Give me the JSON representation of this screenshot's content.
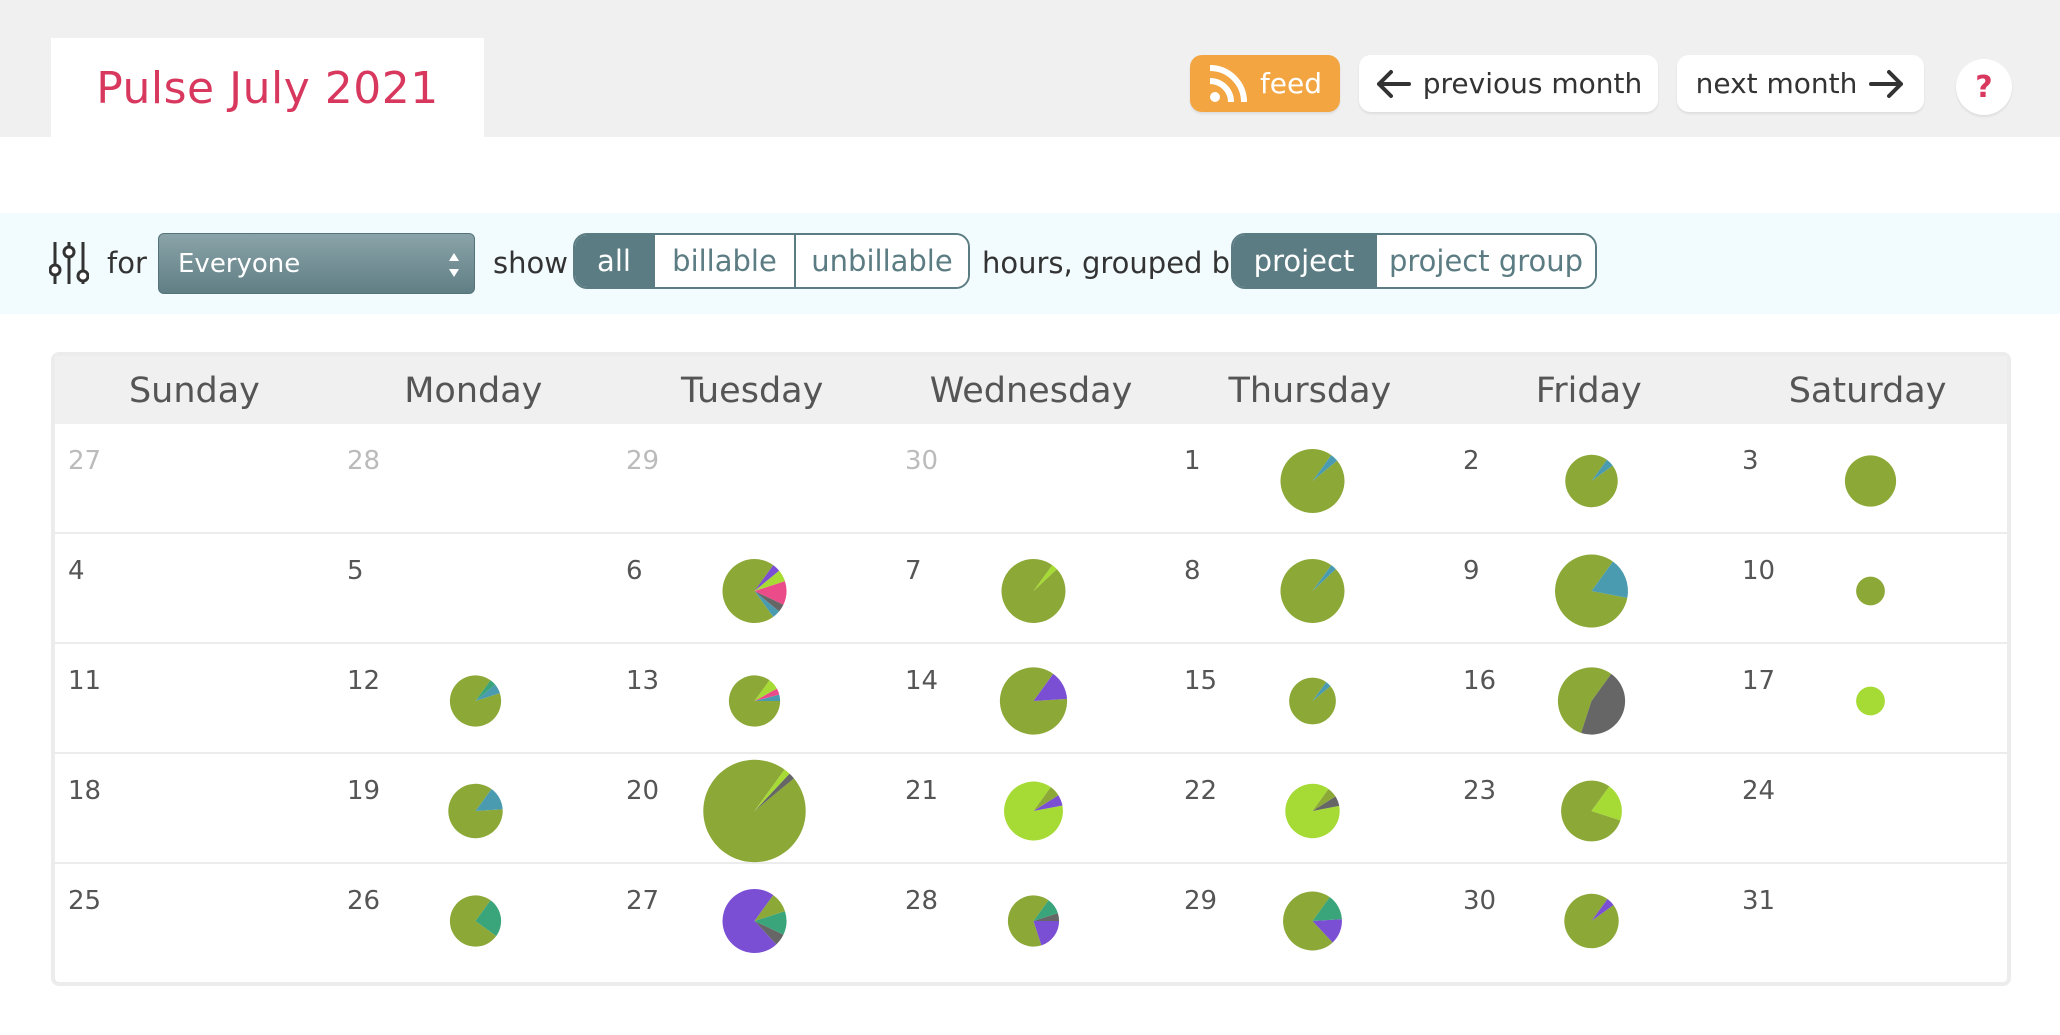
{
  "title": "Pulse July 2021",
  "nav": {
    "feed_label": "feed",
    "prev_label": "previous month",
    "next_label": "next month",
    "help_label": "?"
  },
  "filter": {
    "for_label": "for",
    "person_select": "Everyone",
    "show_label": "show",
    "hours_options": [
      "all",
      "billable",
      "unbillable"
    ],
    "hours_selected": "all",
    "grouped_label": "hours, grouped by",
    "group_options": [
      "project",
      "project group"
    ],
    "group_selected": "project"
  },
  "colors": {
    "accent": "#d8385e",
    "feed": "#f2a541",
    "segment": "#5b7c82",
    "olive": "#8ca836",
    "lime": "#a6da34",
    "teal": "#4b9bb0",
    "purple": "#7b4fd4",
    "pink": "#ea4b89",
    "gray": "#666666",
    "green": "#3aa47a"
  },
  "calendar": {
    "weekdays": [
      "Sunday",
      "Monday",
      "Tuesday",
      "Wednesday",
      "Thursday",
      "Friday",
      "Saturday"
    ],
    "weeks": [
      [
        {
          "day": "27",
          "other": true
        },
        {
          "day": "28",
          "other": true
        },
        {
          "day": "29",
          "other": true
        },
        {
          "day": "30",
          "other": true
        },
        {
          "day": "1",
          "size": 1.0,
          "slices": [
            [
              "olive",
              0.96
            ],
            [
              "teal",
              0.04
            ]
          ]
        },
        {
          "day": "2",
          "size": 0.82,
          "slices": [
            [
              "olive",
              0.95
            ],
            [
              "teal",
              0.05
            ]
          ]
        },
        {
          "day": "3",
          "size": 0.8,
          "slices": [
            [
              "olive",
              1.0
            ]
          ]
        }
      ],
      [
        {
          "day": "4"
        },
        {
          "day": "5"
        },
        {
          "day": "6",
          "size": 1.0,
          "slices": [
            [
              "olive",
              0.7
            ],
            [
              "teal",
              0.04
            ],
            [
              "gray",
              0.04
            ],
            [
              "pink",
              0.12
            ],
            [
              "lime",
              0.06
            ],
            [
              "purple",
              0.04
            ]
          ]
        },
        {
          "day": "7",
          "size": 1.0,
          "slices": [
            [
              "olive",
              0.97
            ],
            [
              "lime",
              0.03
            ]
          ]
        },
        {
          "day": "8",
          "size": 1.0,
          "slices": [
            [
              "olive",
              0.97
            ],
            [
              "teal",
              0.03
            ]
          ]
        },
        {
          "day": "9",
          "size": 1.14,
          "slices": [
            [
              "olive",
              0.82
            ],
            [
              "teal",
              0.18
            ]
          ]
        },
        {
          "day": "10",
          "size": 0.45,
          "slices": [
            [
              "olive",
              1.0
            ]
          ]
        }
      ],
      [
        {
          "day": "11"
        },
        {
          "day": "12",
          "size": 0.8,
          "slices": [
            [
              "olive",
              0.9
            ],
            [
              "teal",
              0.06
            ],
            [
              "green",
              0.04
            ]
          ]
        },
        {
          "day": "13",
          "size": 0.8,
          "slices": [
            [
              "olive",
              0.85
            ],
            [
              "teal",
              0.04
            ],
            [
              "pink",
              0.04
            ],
            [
              "lime",
              0.07
            ]
          ]
        },
        {
          "day": "14",
          "size": 1.05,
          "slices": [
            [
              "olive",
              0.86
            ],
            [
              "purple",
              0.14
            ]
          ]
        },
        {
          "day": "15",
          "size": 0.73,
          "slices": [
            [
              "olive",
              0.96
            ],
            [
              "teal",
              0.04
            ]
          ]
        },
        {
          "day": "16",
          "size": 1.05,
          "slices": [
            [
              "olive",
              0.55
            ],
            [
              "gray",
              0.45
            ]
          ]
        },
        {
          "day": "17",
          "size": 0.45,
          "slices": [
            [
              "lime",
              1.0
            ]
          ]
        }
      ],
      [
        {
          "day": "18"
        },
        {
          "day": "19",
          "size": 0.85,
          "slices": [
            [
              "olive",
              0.86
            ],
            [
              "teal",
              0.14
            ]
          ]
        },
        {
          "day": "20",
          "size": 1.6,
          "slices": [
            [
              "olive",
              0.96
            ],
            [
              "gray",
              0.02
            ],
            [
              "lime",
              0.02
            ]
          ]
        },
        {
          "day": "21",
          "size": 0.92,
          "slices": [
            [
              "lime",
              0.88
            ],
            [
              "purple",
              0.06
            ],
            [
              "olive",
              0.06
            ]
          ]
        },
        {
          "day": "22",
          "size": 0.85,
          "slices": [
            [
              "lime",
              0.88
            ],
            [
              "gray",
              0.06
            ],
            [
              "olive",
              0.06
            ]
          ]
        },
        {
          "day": "23",
          "size": 0.95,
          "slices": [
            [
              "olive",
              0.8
            ],
            [
              "lime",
              0.2
            ]
          ]
        },
        {
          "day": "24"
        }
      ],
      [
        {
          "day": "25"
        },
        {
          "day": "26",
          "size": 0.8,
          "slices": [
            [
              "olive",
              0.75
            ],
            [
              "green",
              0.25
            ]
          ]
        },
        {
          "day": "27",
          "size": 1.0,
          "slices": [
            [
              "purple",
              0.72
            ],
            [
              "gray",
              0.06
            ],
            [
              "green",
              0.12
            ],
            [
              "olive",
              0.1
            ]
          ]
        },
        {
          "day": "28",
          "size": 0.8,
          "slices": [
            [
              "olive",
              0.65
            ],
            [
              "purple",
              0.2
            ],
            [
              "gray",
              0.05
            ],
            [
              "green",
              0.1
            ]
          ]
        },
        {
          "day": "29",
          "size": 0.92,
          "slices": [
            [
              "olive",
              0.72
            ],
            [
              "purple",
              0.14
            ],
            [
              "green",
              0.14
            ]
          ]
        },
        {
          "day": "30",
          "size": 0.85,
          "slices": [
            [
              "olive",
              0.95
            ],
            [
              "purple",
              0.05
            ]
          ]
        },
        {
          "day": "31"
        }
      ]
    ]
  }
}
